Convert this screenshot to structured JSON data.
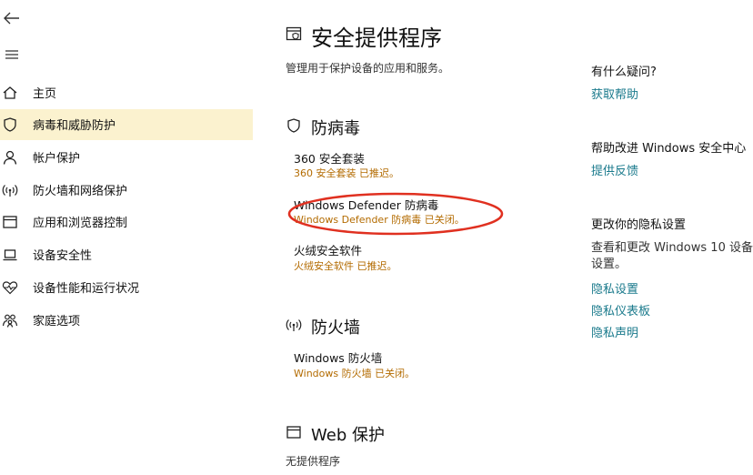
{
  "colors": {
    "selected_nav_bg": "#fbf2cf",
    "link": "#1a7a8c",
    "status_text": "#b36b00",
    "annotation_ellipse": "#e03020"
  },
  "top": {
    "back_icon": "back-arrow-icon",
    "menu_icon": "hamburger-menu-icon"
  },
  "sidebar": {
    "items": [
      {
        "label": "主页",
        "icon": "home-icon"
      },
      {
        "label": "病毒和威胁防护",
        "icon": "shield-icon",
        "selected": true
      },
      {
        "label": "帐户保护",
        "icon": "person-icon"
      },
      {
        "label": "防火墙和网络保护",
        "icon": "wifi-signal-icon"
      },
      {
        "label": "应用和浏览器控制",
        "icon": "app-window-icon"
      },
      {
        "label": "设备安全性",
        "icon": "laptop-icon"
      },
      {
        "label": "设备性能和运行状况",
        "icon": "heart-pulse-icon"
      },
      {
        "label": "家庭选项",
        "icon": "family-icon"
      }
    ]
  },
  "main": {
    "title": "安全提供程序",
    "subtitle": "管理用于保护设备的应用和服务。",
    "antivirus": {
      "title": "防病毒",
      "providers": [
        {
          "name": "360 安全套装",
          "status": "360 安全套装 已推迟。"
        },
        {
          "name": "Windows Defender 防病毒",
          "status": "Windows Defender 防病毒 已关闭。"
        },
        {
          "name": "火绒安全软件",
          "status": "火绒安全软件 已推迟。"
        }
      ]
    },
    "firewall": {
      "title": "防火墙",
      "providers": [
        {
          "name": "Windows 防火墙",
          "status": "Windows 防火墙 已关闭。"
        }
      ]
    },
    "web": {
      "title": "Web 保护",
      "text": "无提供程序"
    }
  },
  "side": {
    "questions": {
      "heading": "有什么疑问?",
      "link": "获取帮助"
    },
    "improve": {
      "heading": "帮助改进 Windows 安全中心",
      "link": "提供反馈"
    },
    "privacy": {
      "heading": "更改你的隐私设置",
      "text_line1": "查看和更改 Windows 10 设备的隐私",
      "text_line2": "设置。",
      "links": [
        "隐私设置",
        "隐私仪表板",
        "隐私声明"
      ]
    }
  }
}
